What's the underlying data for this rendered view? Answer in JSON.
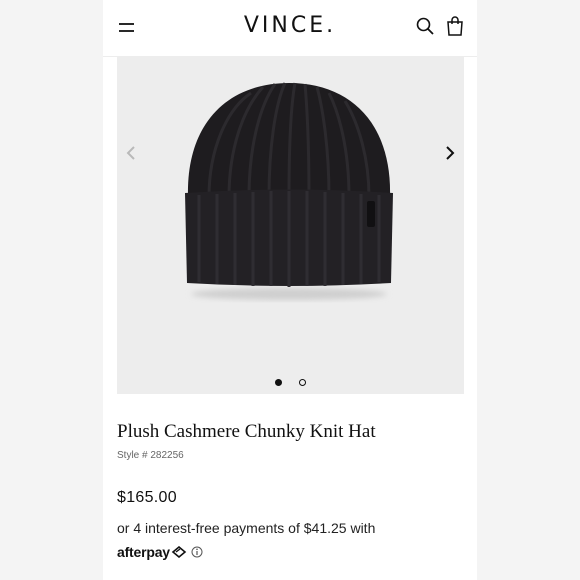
{
  "header": {
    "logo": "VINCE."
  },
  "gallery": {
    "slide_count": 2,
    "active_slide": 1
  },
  "product": {
    "title": "Plush Cashmere Chunky Knit Hat",
    "style_number": "Style # 282256",
    "price": "$165.00",
    "installment_text": "or 4 interest-free payments of $41.25 with",
    "payment_provider": "afterpay"
  },
  "icons": {
    "menu": "hamburger-menu-icon",
    "search": "search-icon",
    "bag": "shopping-bag-icon",
    "prev": "chevron-left-icon",
    "next": "chevron-right-icon",
    "info": "info-icon"
  },
  "colors": {
    "text": "#111111",
    "image_background": "#ededed",
    "hat": "#1e1c1f"
  }
}
